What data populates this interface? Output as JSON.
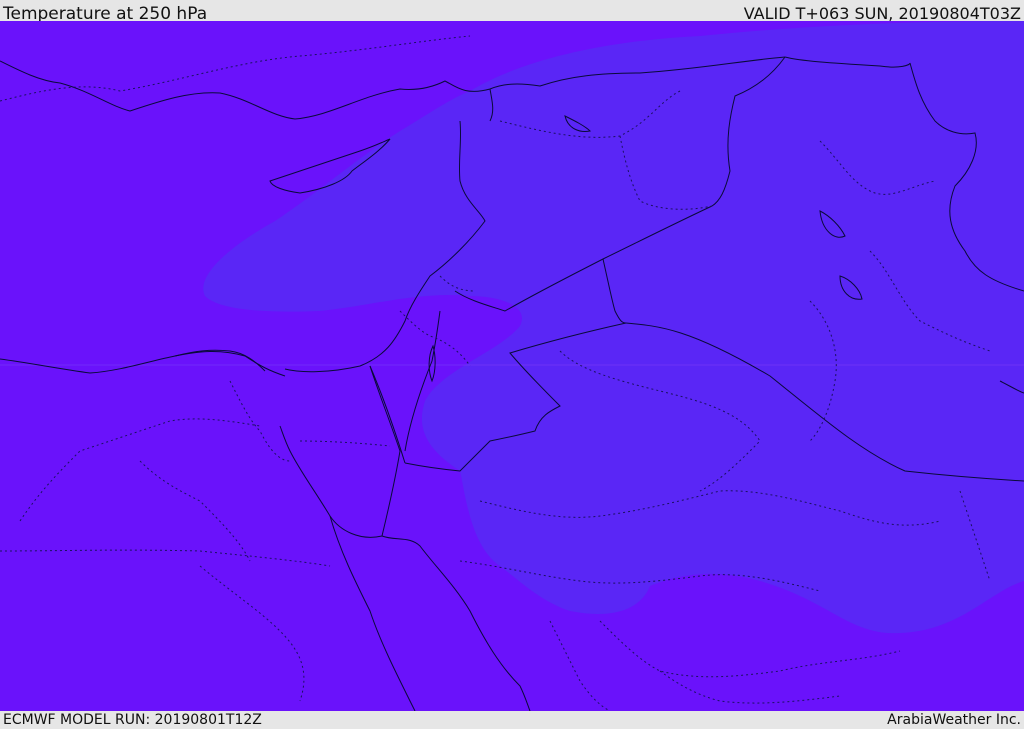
{
  "header": {
    "title": "Temperature at 250 hPa",
    "valid": "VALID T+063 SUN, 20190804T03Z"
  },
  "footer": {
    "model_run": "ECMWF MODEL RUN: 20190801T12Z",
    "credit": "ArabiaWeather Inc."
  },
  "colors": {
    "field_cold": "#6a12fb",
    "field_warm": "#5a26f6",
    "coast": "#0a0a3a",
    "frame": "#e6e6e6"
  }
}
